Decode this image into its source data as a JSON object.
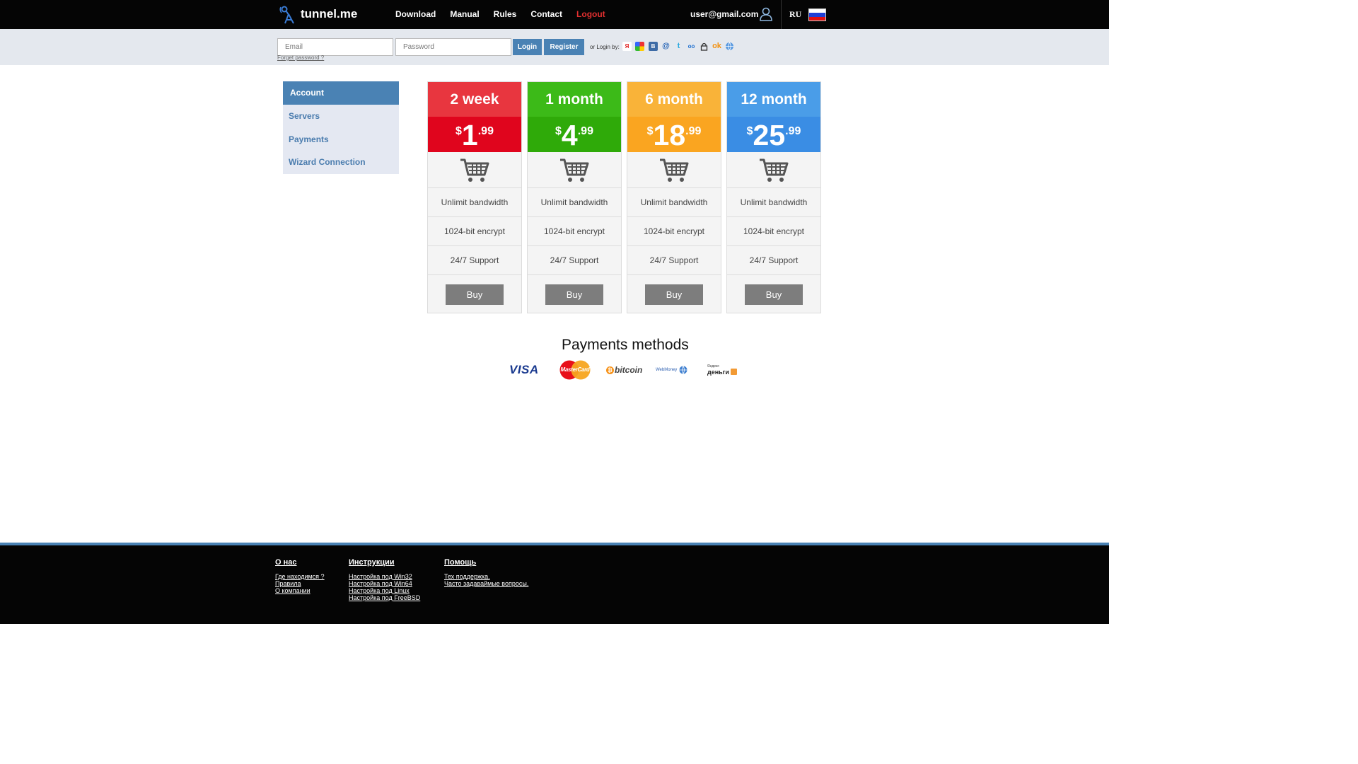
{
  "header": {
    "logo_text": "tunnel.me",
    "nav": [
      {
        "label": "Download"
      },
      {
        "label": "Manual"
      },
      {
        "label": "Rules"
      },
      {
        "label": "Contact"
      },
      {
        "label": "Logout"
      }
    ],
    "user_email": "user@gmail.com",
    "language": "RU"
  },
  "login": {
    "email_placeholder": "Email",
    "password_placeholder": "Password",
    "login_label": "Login",
    "register_label": "Register",
    "forget_label": "Forget password ?",
    "or_login_label": "or Login by:"
  },
  "sidebar": {
    "items": [
      {
        "label": "Account"
      },
      {
        "label": "Servers"
      },
      {
        "label": "Payments"
      },
      {
        "label": "Wizard Connection"
      }
    ]
  },
  "plans": [
    {
      "period": "2 week",
      "currency": "$",
      "price": "1",
      "cents": ".99",
      "head_color": "#e8363f",
      "price_color": "#e0051d",
      "features": [
        "Unlimit bandwidth",
        "1024-bit encrypt",
        "24/7 Support"
      ],
      "buy_label": "Buy"
    },
    {
      "period": "1 month",
      "currency": "$",
      "price": "4",
      "cents": ".99",
      "head_color": "#3cba18",
      "price_color": "#2faa09",
      "features": [
        "Unlimit bandwidth",
        "1024-bit encrypt",
        "24/7 Support"
      ],
      "buy_label": "Buy"
    },
    {
      "period": "6 month",
      "currency": "$",
      "price": "18",
      "cents": ".99",
      "head_color": "#f9b339",
      "price_color": "#faa520",
      "features": [
        "Unlimit bandwidth",
        "1024-bit encrypt",
        "24/7 Support"
      ],
      "buy_label": "Buy"
    },
    {
      "period": "12 month",
      "currency": "$",
      "price": "25",
      "cents": ".99",
      "head_color": "#4a9de8",
      "price_color": "#3a8de4",
      "features": [
        "Unlimit bandwidth",
        "1024-bit encrypt",
        "24/7 Support"
      ],
      "buy_label": "Buy"
    }
  ],
  "payments": {
    "title": "Payments methods",
    "visa": "VISA",
    "mastercard": "MasterCard",
    "bitcoin": "bitcoin",
    "webmoney": "WebMoney",
    "yandex_top": "Яндекс",
    "yandex_bottom": "деньги"
  },
  "footer": {
    "col1": {
      "title": "О нас",
      "links": [
        "Где находимся ?",
        "Правила",
        "О компании"
      ]
    },
    "col2": {
      "title": "Инструкции",
      "links": [
        "Настройка под Win32",
        "Настройка под Win64",
        "Настройка под Linux",
        "Настройка под FreeBSD"
      ]
    },
    "col3": {
      "title": "Помощь",
      "links": [
        "Тех поддержка.",
        "Часто задаваймые вопросы."
      ]
    }
  }
}
